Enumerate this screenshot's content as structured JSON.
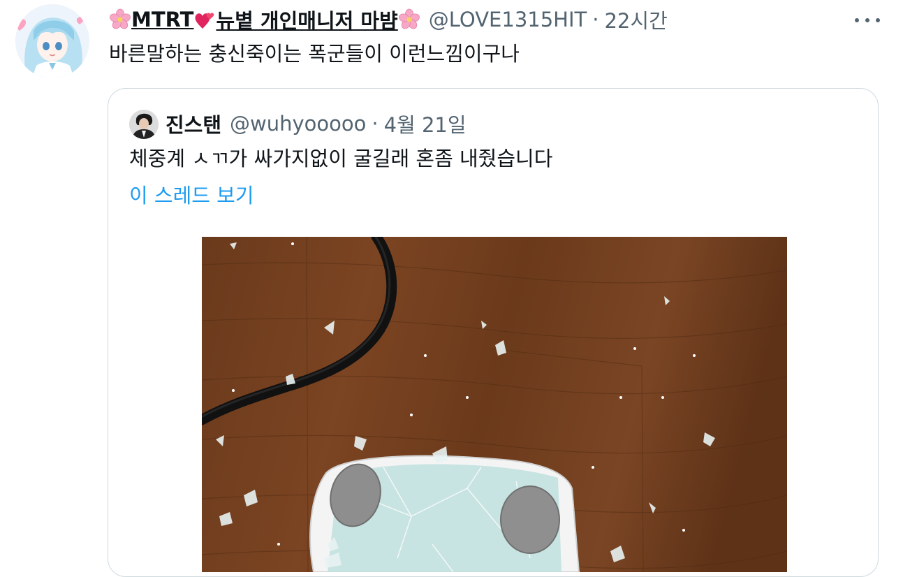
{
  "tweet": {
    "author_name": "MTRT",
    "author_name_suffix": "뉴볕 개인매니저 마뱜",
    "handle": "@LOVE1315HIT",
    "separator": "·",
    "time": "22시간",
    "text": "바른말하는 충신죽이는 폭군들이 이런느낌이구나"
  },
  "quote": {
    "author_name": "진스탠",
    "handle": "@wuhyooooo",
    "separator": "·",
    "date": "4월 21일",
    "text": "체중계 ㅅㄲ가 싸가지없이 굴길래 혼좀 내줬습니다",
    "thread_link": "이 스레드 보기"
  },
  "icons": {
    "flower": "cherry-blossom-icon",
    "heart": "two-hearts-icon",
    "more": "more-options-icon"
  },
  "colors": {
    "link": "#1d9bf0",
    "secondary_text": "#536471",
    "border": "#cfd9de"
  }
}
